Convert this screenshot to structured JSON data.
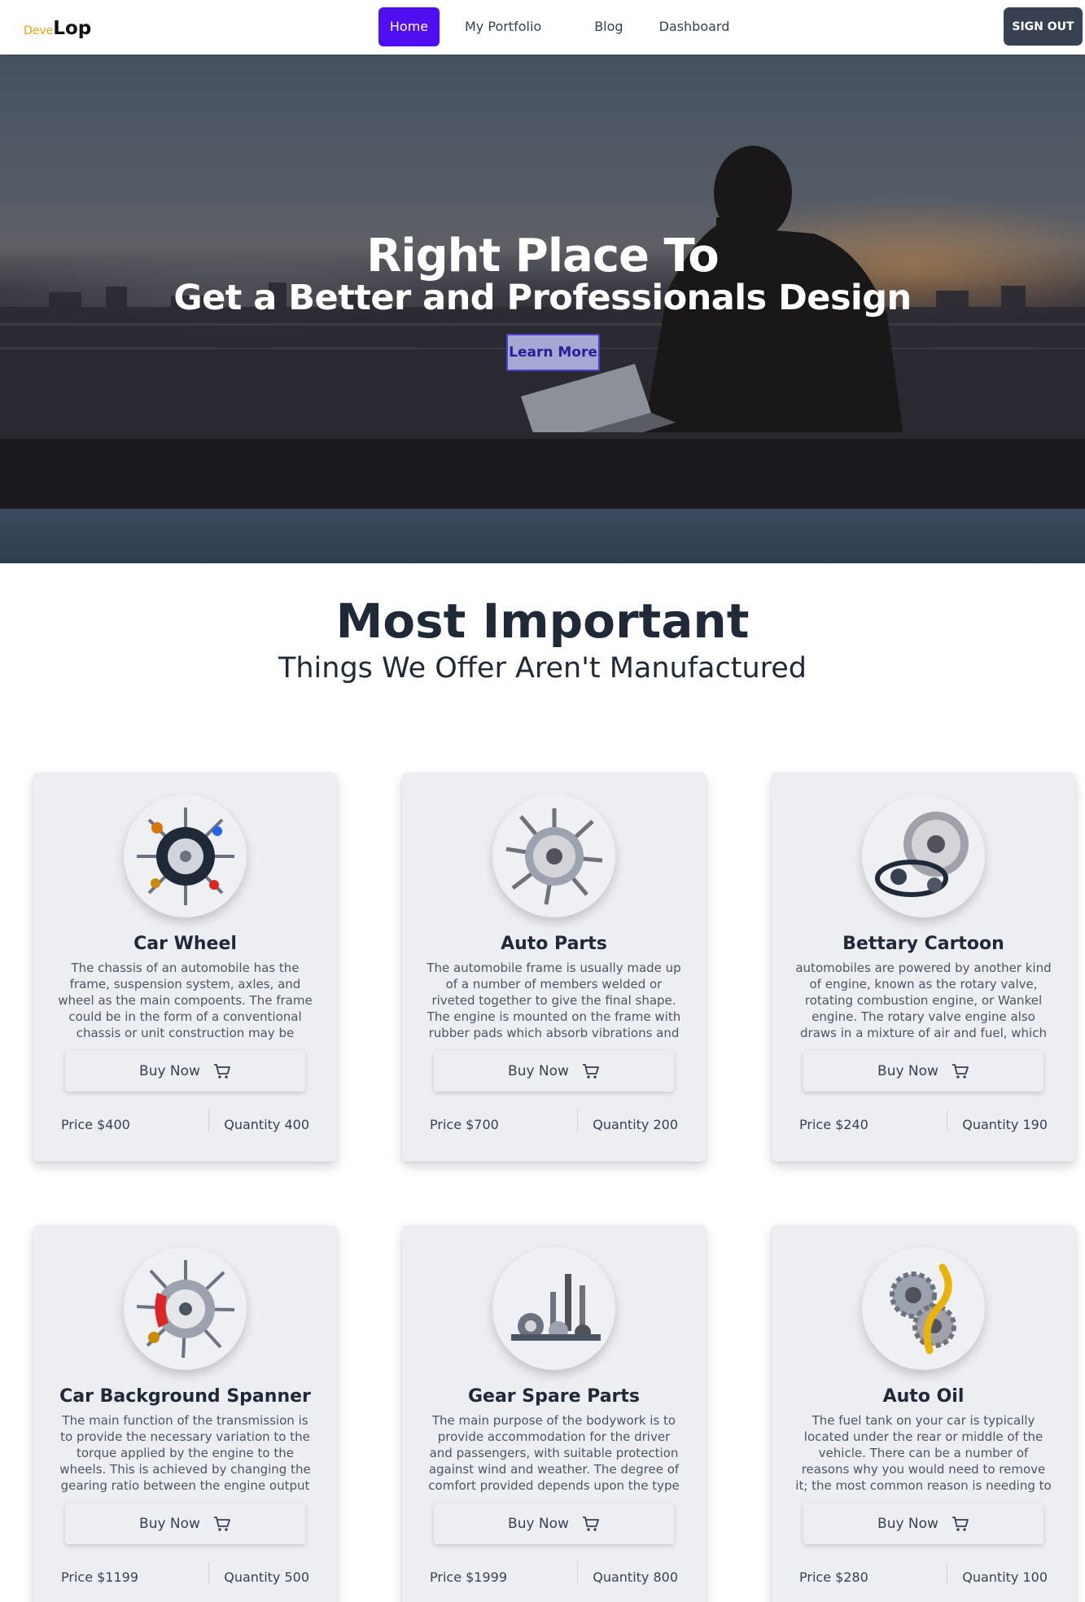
{
  "brand": {
    "logo_prefix": "Deve",
    "logo_main": "Lop",
    "accent": "#4f0ff0",
    "logo_accent": "#f59e0b"
  },
  "nav": {
    "links": [
      "Home",
      "My Portfolio",
      "Blog",
      "Dashboard"
    ],
    "active": "Home",
    "signout_label": "SIGN OUT"
  },
  "hero": {
    "title": "Right Place To",
    "subtitle": "Get a Better and Professionals Design",
    "cta_label": "Learn More"
  },
  "section": {
    "title": "Most Important",
    "subtitle": "Things We Offer Aren't Manufactured"
  },
  "products": [
    {
      "name": "Car Wheel",
      "description": "The chassis of an automobile has the frame, suspension system, axles, and wheel as the main compoents. The frame could be in the form of a conventional chassis or unit construction may be adopted main",
      "buy_label": "Buy Now",
      "price": "Price $400",
      "quantity": "Quantity 400",
      "image_icon": "car-parts-wheel-icon"
    },
    {
      "name": "Auto Parts",
      "description": "The automobile frame is usually made up of a number of members welded or riveted together to give the final shape. The engine is mounted on the frame with rubber pads which absorb vibrations and also",
      "buy_label": "Buy Now",
      "price": "Price $700",
      "quantity": "Quantity 200",
      "image_icon": "brake-disc-parts-icon"
    },
    {
      "name": "Bettary Cartoon",
      "description": "automobiles are powered by another kind of engine, known as the rotary valve, rotating combustion engine, or Wankel engine. The rotary valve engine also draws in a mixture of air and fuel, which is th",
      "buy_label": "Buy Now",
      "price": "Price $240",
      "quantity": "Quantity 190",
      "image_icon": "brake-disc-belt-icon"
    },
    {
      "name": "Car Background Spanner",
      "description": "The main function of the transmission is to provide the necessary variation to the torque applied by the engine to the wheels. This is achieved by changing the gearing ratio between the engine output",
      "buy_label": "Buy Now",
      "price": "Price $1199",
      "quantity": "Quantity 500",
      "image_icon": "brake-caliper-parts-icon"
    },
    {
      "name": "Gear Spare Parts",
      "description": "The main purpose of the bodywork is to provide accommodation for the driver and passengers, with suitable protection against wind and weather. The degree of comfort provided depends upon the type of c",
      "buy_label": "Buy Now",
      "price": "Price $1999",
      "quantity": "Quantity 800",
      "image_icon": "gear-shafts-icon"
    },
    {
      "name": "Auto Oil",
      "description": "The fuel tank on your car is typically located under the rear or middle of the vehicle. There can be a number of reasons why you would need to remove it; the most common reason is needing to replace t",
      "buy_label": "Buy Now",
      "price": "Price $280",
      "quantity": "Quantity 100",
      "image_icon": "gold-gears-icon"
    }
  ]
}
